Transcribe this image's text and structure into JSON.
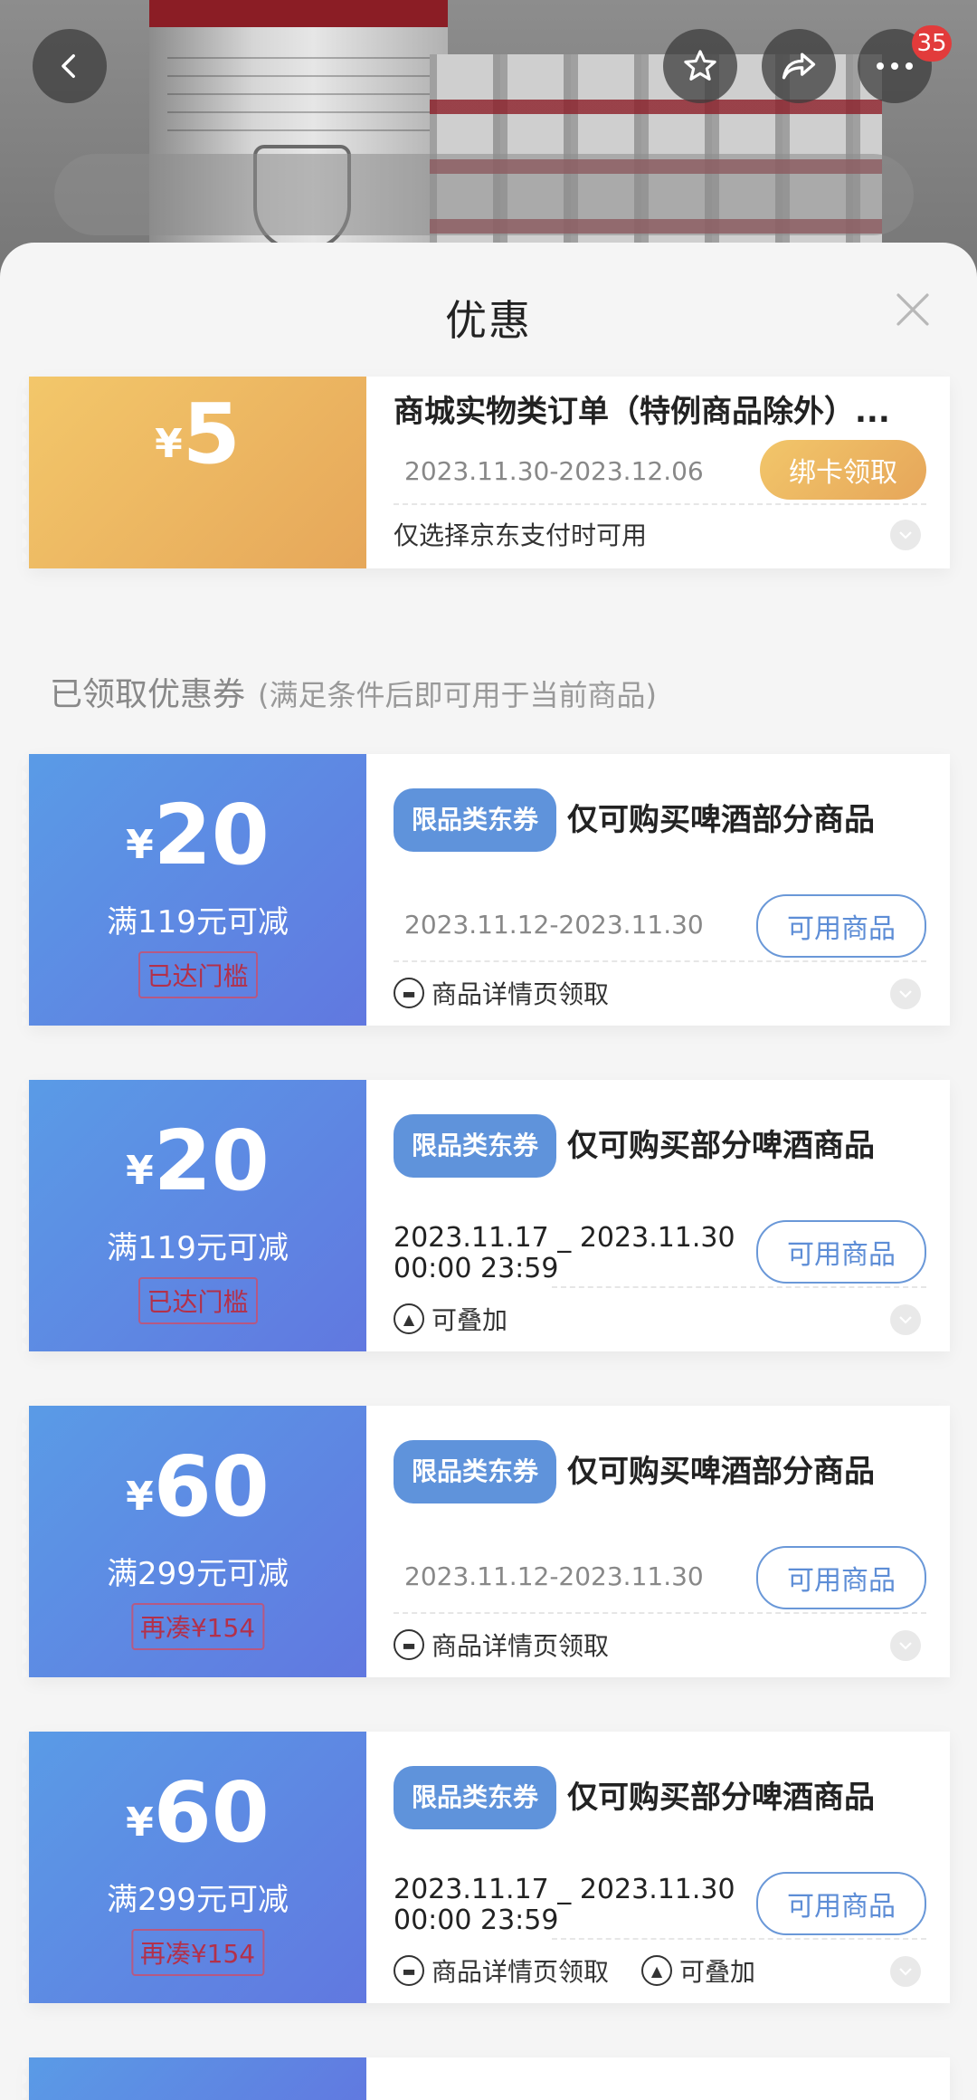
{
  "header": {
    "cart_badge": "35",
    "back_icon": "chevron-left-icon",
    "favorite_icon": "star-icon",
    "share_icon": "share-icon",
    "more_icon": "more-dots-icon"
  },
  "sheet": {
    "title": "优惠",
    "close_icon": "close-icon"
  },
  "promo": {
    "yen": "¥",
    "amount": "5",
    "title": "商城实物类订单（特例商品除外）...",
    "date": "2023.11.30-2023.12.06",
    "button": "绑卡领取",
    "note": "仅选择京东支付时可用"
  },
  "section": {
    "title": "已领取优惠券",
    "subtitle": "(满足条件后即可用于当前商品)"
  },
  "coupons": [
    {
      "yen": "¥",
      "amount": "20",
      "condition": "满119元可减",
      "status": "已达门槛",
      "tag": "限品类东券",
      "title": "仅可购买啤酒部分商品",
      "date": "2023.11.12-2023.11.30",
      "button": "可用商品",
      "foot1": "商品详情页领取"
    },
    {
      "yen": "¥",
      "amount": "20",
      "condition": "满119元可减",
      "status": "已达门槛",
      "tag": "限品类东券",
      "title": "仅可购买部分啤酒商品",
      "date_line1": "2023.11.17 _ 2023.11.30",
      "date_line2": "00:00 23:59",
      "button": "可用商品",
      "foot2": "可叠加"
    },
    {
      "yen": "¥",
      "amount": "60",
      "condition": "满299元可减",
      "status": "再凑¥154",
      "tag": "限品类东券",
      "title": "仅可购买啤酒部分商品",
      "date": "2023.11.12-2023.11.30",
      "button": "可用商品",
      "foot1": "商品详情页领取"
    },
    {
      "yen": "¥",
      "amount": "60",
      "condition": "满299元可减",
      "status": "再凑¥154",
      "tag": "限品类东券",
      "title": "仅可购买部分啤酒商品",
      "date_line1": "2023.11.17 _ 2023.11.30",
      "date_line2": "00:00 23:59",
      "button": "可用商品",
      "foot1": "商品详情页领取",
      "foot2": "可叠加"
    }
  ],
  "colors": {
    "accent_blue": "#5f93db",
    "gold": "#e6a75a",
    "badge_red": "#e23b3b"
  }
}
